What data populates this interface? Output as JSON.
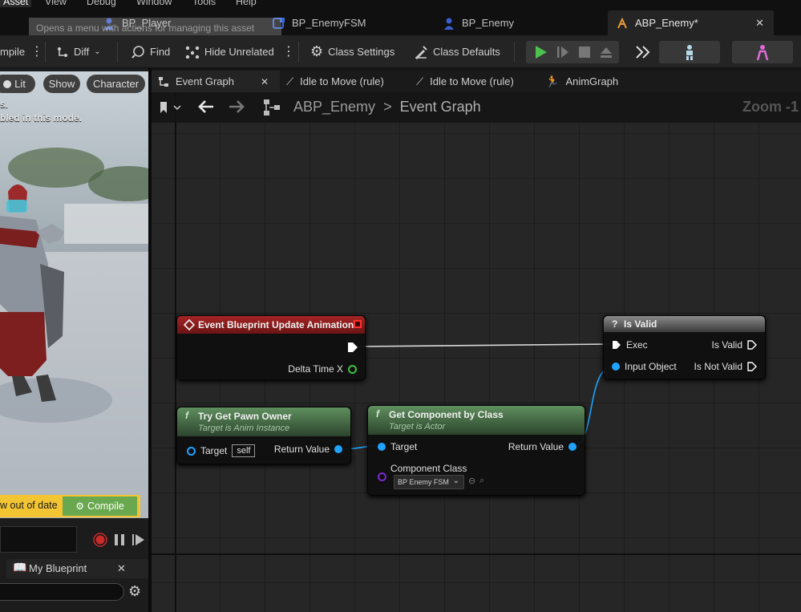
{
  "menu": {
    "items": [
      "Asset",
      "View",
      "Debug",
      "Window",
      "Tools",
      "Help"
    ]
  },
  "doc_tabs": [
    {
      "label": "BP_Player"
    },
    {
      "label": "BP_EnemyFSM"
    },
    {
      "label": "BP_Enemy"
    },
    {
      "label": "ABP_Enemy*"
    }
  ],
  "tooltip": {
    "text": "Opens a menu with actions for managing this asset"
  },
  "toolbar": {
    "compile": "mpile",
    "diff": "Diff",
    "find": "Find",
    "hide_unrelated": "Hide Unrelated",
    "class_settings": "Class Settings",
    "class_defaults": "Class Defaults"
  },
  "viewport": {
    "lit": "Lit",
    "show": "Show",
    "character": "Character",
    "msg1": "s.",
    "msg2": "bled in this mode.",
    "out_of_date": "w out of date",
    "compile": "Compile"
  },
  "my_blueprint": {
    "label": "My Blueprint"
  },
  "graph_tabs": [
    {
      "label": "Event Graph"
    },
    {
      "label": "Idle to Move (rule)"
    },
    {
      "label": "Idle to Move (rule)"
    },
    {
      "label": "AnimGraph"
    }
  ],
  "breadcrumb": {
    "root": "ABP_Enemy",
    "sep": ">",
    "current": "Event Graph"
  },
  "zoom": {
    "label": "Zoom -1"
  },
  "nodes": {
    "event_update": {
      "title": "Event Blueprint Update Animation",
      "out": "Delta Time X"
    },
    "try_get_pawn": {
      "title": "Try Get Pawn Owner",
      "subtitle": "Target is Anim Instance",
      "target": "Target",
      "self": "self",
      "ret": "Return Value"
    },
    "get_component": {
      "title": "Get Component by Class",
      "subtitle": "Target is Actor",
      "target": "Target",
      "ret": "Return Value",
      "class_label": "Component Class",
      "class_value": "BP Enemy FSM"
    },
    "is_valid": {
      "title": "Is Valid",
      "exec": "Exec",
      "input": "Input Object",
      "valid": "Is Valid",
      "not_valid": "Is Not Valid"
    }
  },
  "colors": {
    "event_header": "#8a1c1c",
    "func_header": "#4e7a4e",
    "exec_wire": "#d8d8d8",
    "object_pin": "#1fa3ff",
    "float_pin": "#3cc03c",
    "compile_bar": "#f3c533"
  }
}
